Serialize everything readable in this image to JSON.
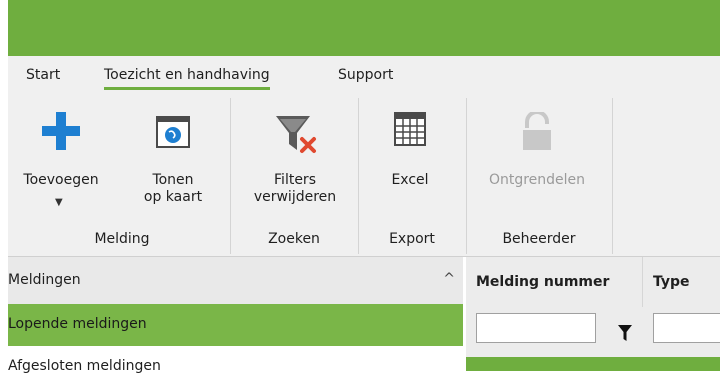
{
  "colors": {
    "brand": "#6fae3f",
    "selected": "#7ab648",
    "ribbon_bg": "#f0f0f0",
    "accent_blue": "#1e7fd1",
    "remove_red": "#e0492f"
  },
  "menu": {
    "tabs": [
      {
        "label": "Start",
        "active": false
      },
      {
        "label": "Toezicht en handhaving",
        "active": true
      },
      {
        "label": "Support",
        "active": false
      }
    ]
  },
  "ribbon": {
    "groups": {
      "melding": "Melding",
      "zoeken": "Zoeken",
      "export": "Export",
      "beheerder": "Beheerder"
    },
    "buttons": {
      "toevoegen": {
        "label": "Toevoegen",
        "icon": "plus-icon"
      },
      "tonen": {
        "line1": "Tonen",
        "line2": "op kaart",
        "icon": "map-globe-icon"
      },
      "filters": {
        "line1": "Filters",
        "line2": "verwijderen",
        "icon": "funnel-remove-icon"
      },
      "excel": {
        "label": "Excel",
        "icon": "spreadsheet-icon"
      },
      "ontgrendelen": {
        "label": "Ontgrendelen",
        "icon": "unlock-icon",
        "disabled": true
      }
    }
  },
  "sidebar": {
    "header": "Meldingen",
    "items": [
      {
        "label": "Lopende meldingen",
        "selected": true
      },
      {
        "label": "Afgesloten meldingen",
        "selected": false
      }
    ]
  },
  "grid": {
    "columns": [
      "Melding nummer",
      "Type"
    ],
    "filter_values": [
      "",
      ""
    ]
  }
}
